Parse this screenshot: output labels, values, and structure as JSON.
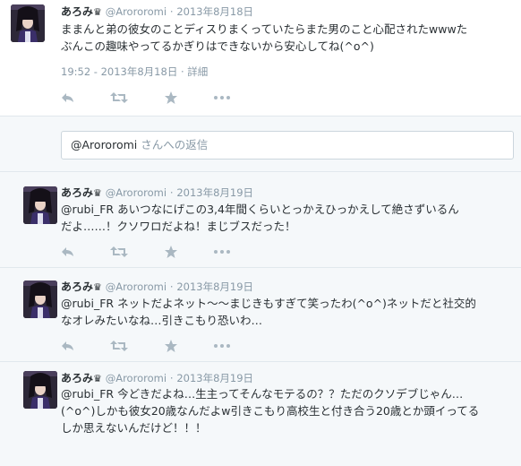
{
  "colors": {
    "accent": "#55acee",
    "muted": "#8899a6",
    "text": "#292f33",
    "reply_bg": "#f5f8fa",
    "border": "#e1e8ed"
  },
  "main_tweet": {
    "name": "あろみ",
    "crown": "♛",
    "handle": "@Arororomi",
    "separator": "·",
    "date": "2013年8月18日",
    "lines": [
      "ままんと弟の彼女のことディスりまくっていたらまた男のこと心配されたwwwた",
      "ぶんこの趣味やってるかぎりはできないから安心してね(^o^)"
    ],
    "timestamp": "19:52 - 2013年8月18日",
    "meta_sep": "·",
    "details_link": "詳細",
    "actions": [
      "reply-icon",
      "retweet-icon",
      "favorite-icon",
      "more-icon"
    ]
  },
  "reply_box": {
    "mention": "@Arororomi",
    "placeholder": " さんへの返信"
  },
  "replies": [
    {
      "name": "あろみ",
      "crown": "♛",
      "handle": "@Arororomi",
      "separator": "·",
      "date": "2013年8月19日",
      "lines": [
        "@rubi_FR あいつなにげこの3,4年間くらいとっかえひっかえして絶さずいるん",
        "だよ……！クソワロだよね！まじブスだった！"
      ]
    },
    {
      "name": "あろみ",
      "crown": "♛",
      "handle": "@Arororomi",
      "separator": "·",
      "date": "2013年8月19日",
      "lines": [
        "@rubi_FR ネットだよネット〜〜まじきもすぎて笑ったわ(^o^)ネットだと社交的",
        "なオレみたいなね…引きこもり恐いわ…"
      ]
    },
    {
      "name": "あろみ",
      "crown": "♛",
      "handle": "@Arororomi",
      "separator": "·",
      "date": "2013年8月19日",
      "lines": [
        "@rubi_FR 今どきだよね…生主ってそんなモテるの？？ただのクソデブじゃん…",
        "(^o^)しかも彼女20歳なんだよw引きこもり高校生と付き合う20歳とか頭イってる",
        "しか思えないんだけど！！！"
      ]
    }
  ]
}
